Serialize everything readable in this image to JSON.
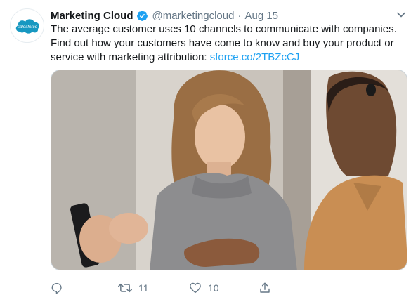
{
  "author": {
    "name": "Marketing Cloud",
    "handle": "@marketingcloud",
    "date": "Aug 15",
    "avatar_text": "salesforce",
    "avatar_icon": "salesforce-logo",
    "verified": true
  },
  "tweet": {
    "line1": "The average customer uses 10 channels to communicate with companies.",
    "line2": "Find out how your customers have come to know and buy your product or",
    "line3_prefix": "service with marketing attribution: ",
    "link": "sforce.co/2TBZcCJ"
  },
  "media": {
    "description": "photo-two-people-looking-at-smartphone"
  },
  "actions": {
    "reply_icon": "reply-icon",
    "retweet_count": "11",
    "like_count": "10",
    "share_icon": "share-icon"
  },
  "colors": {
    "accent": "#1da1f2",
    "secondary_text": "#657786",
    "brand_salesforce": "#1798c1"
  }
}
